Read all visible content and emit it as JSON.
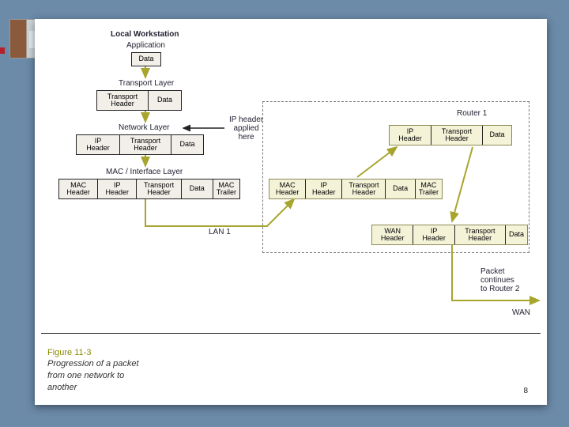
{
  "title": "Local Workstation",
  "layers": {
    "app": "Application",
    "data": "Data",
    "transport": "Transport Layer",
    "network": "Network Layer",
    "mac": "MAC / Interface Layer"
  },
  "hdr": {
    "transport": "Transport\nHeader",
    "ip": "IP\nHeader",
    "mac": "MAC\nHeader",
    "mac_trailer": "MAC\nTrailer",
    "wan": "WAN\nHeader",
    "data": "Data"
  },
  "annot": {
    "ip_applied": "IP header\napplied\nhere",
    "lan1": "LAN 1",
    "router1": "Router 1",
    "continues": "Packet continues\nto Router 2",
    "wan": "WAN"
  },
  "caption": {
    "figno": "Figure 11-3",
    "text": "Progression of a packet\nfrom one network to\nanother"
  },
  "page": "8"
}
